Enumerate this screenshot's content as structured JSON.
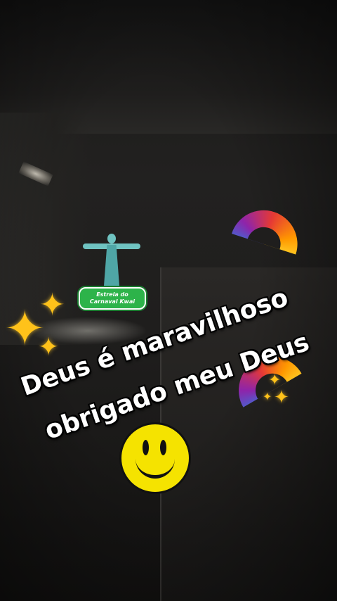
{
  "caption": {
    "line1": "Deus é maravilhoso",
    "line2": "obrigado meu Deus",
    "text_color": "#ffffff",
    "outline_color": "#000000"
  },
  "badge": {
    "line1": "Estrela do",
    "line2": "Carnaval Kwai",
    "color": "#2db34a"
  },
  "stickers": {
    "statue_icon": "christ-the-redeemer-icon",
    "sparkles_icon": "sparkles-icon",
    "rainbow_icon": "rainbow-icon",
    "smiley_icon": "smiley-face-icon"
  }
}
